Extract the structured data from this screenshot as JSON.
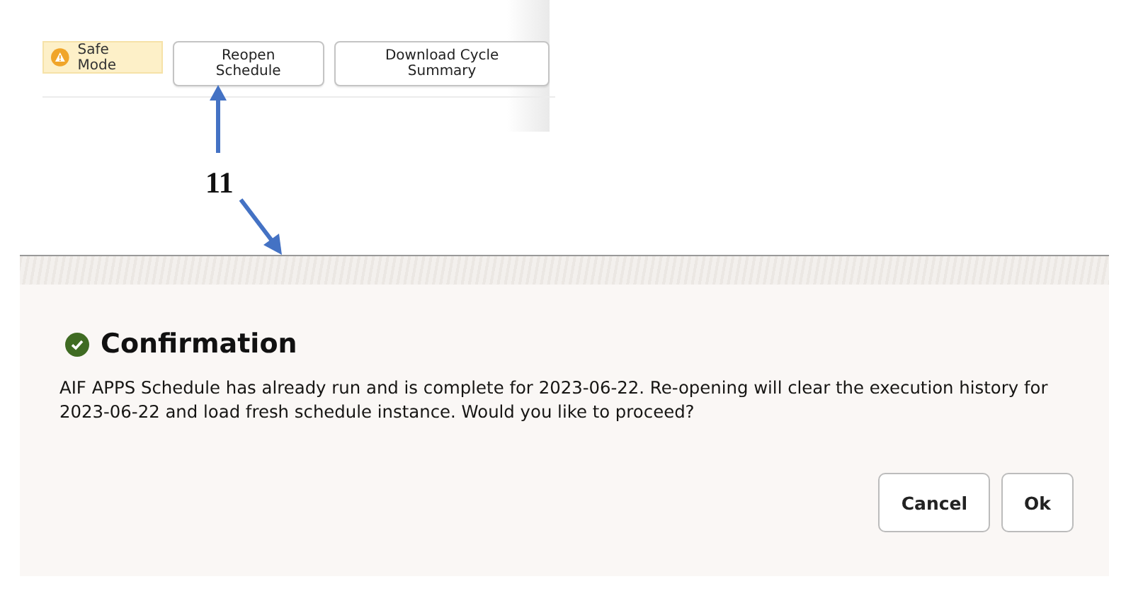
{
  "toolbar": {
    "badge": {
      "label": "Safe Mode"
    },
    "buttons": [
      "Reopen Schedule",
      "Download Cycle Summary"
    ]
  },
  "annotation": {
    "label": "11"
  },
  "dialog": {
    "title": "Confirmation",
    "message": "AIF APPS Schedule has already run and is complete for 2023-06-22. Re-opening will clear the execution history for 2023-06-22 and load fresh schedule instance. Would you like to proceed?",
    "buttons": [
      "Cancel",
      "Ok"
    ]
  }
}
